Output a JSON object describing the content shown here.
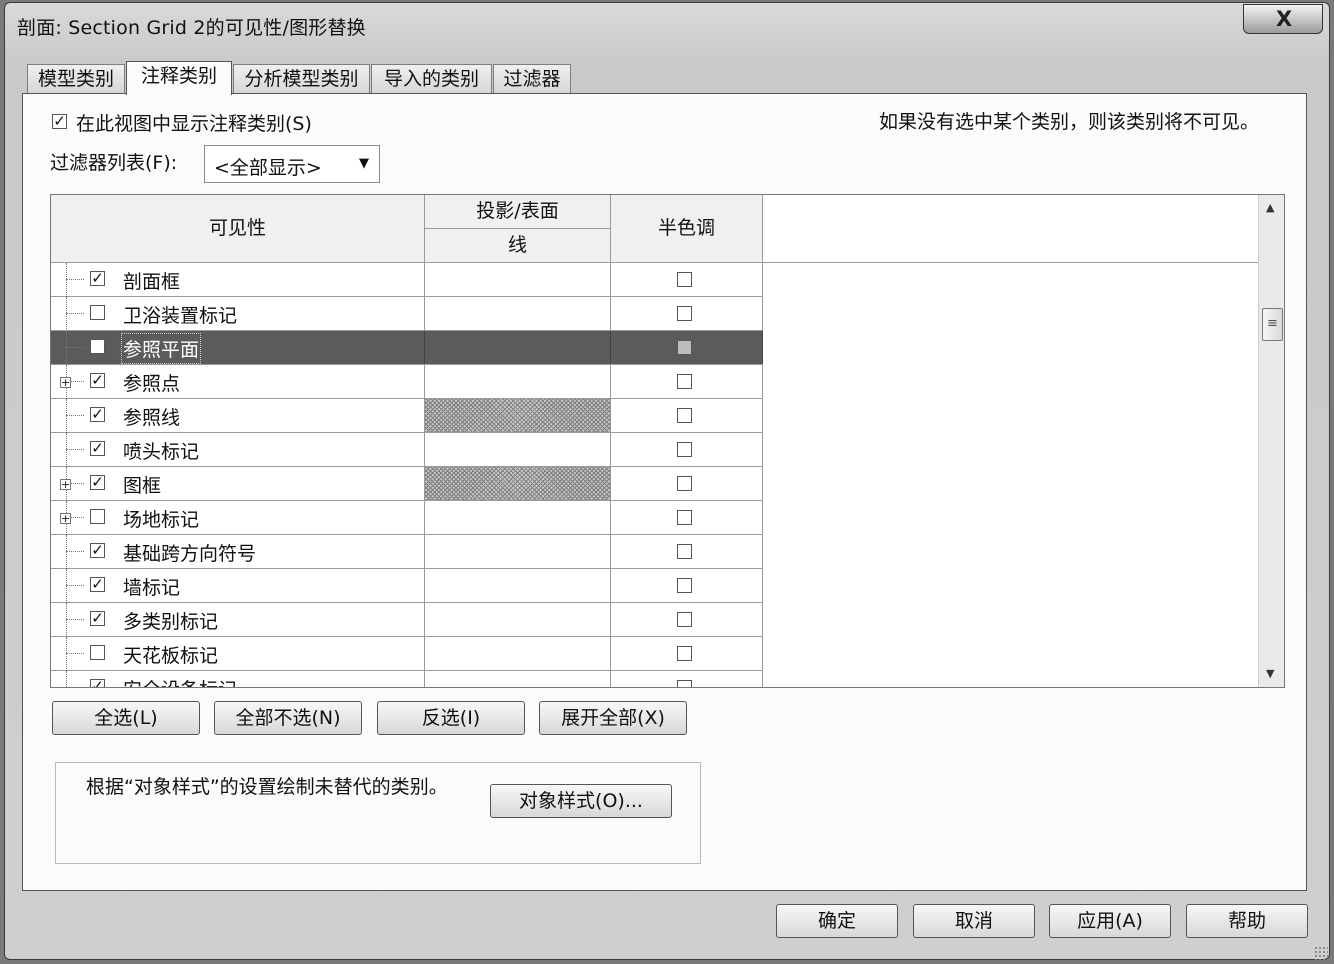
{
  "window": {
    "title": "剖面: Section Grid 2的可见性/图形替换",
    "close_label": "X"
  },
  "tabs": [
    {
      "label": "模型类别",
      "active": false
    },
    {
      "label": "注释类别",
      "active": true
    },
    {
      "label": "分析模型类别",
      "active": false
    },
    {
      "label": "导入的类别",
      "active": false
    },
    {
      "label": "过滤器",
      "active": false
    }
  ],
  "show_annotations": {
    "label": "在此视图中显示注释类别(S)",
    "checked": true
  },
  "info_text": "如果没有选中某个类别，则该类别将不可见。",
  "filter": {
    "label": "过滤器列表(F):",
    "value": "<全部显示>"
  },
  "grid": {
    "headers": {
      "visibility": "可见性",
      "projection": "投影/表面",
      "line": "线",
      "halftone": "半色调"
    },
    "rows": [
      {
        "name": "剖面框",
        "visible": true,
        "expandable": false,
        "hatched": false,
        "halftone": false,
        "selected": false
      },
      {
        "name": "卫浴装置标记",
        "visible": false,
        "expandable": false,
        "hatched": false,
        "halftone": false,
        "selected": false
      },
      {
        "name": "参照平面",
        "visible": false,
        "expandable": false,
        "hatched": false,
        "halftone": false,
        "selected": true
      },
      {
        "name": "参照点",
        "visible": true,
        "expandable": true,
        "hatched": false,
        "halftone": false,
        "selected": false
      },
      {
        "name": "参照线",
        "visible": true,
        "expandable": false,
        "hatched": true,
        "halftone": false,
        "selected": false
      },
      {
        "name": "喷头标记",
        "visible": true,
        "expandable": false,
        "hatched": false,
        "halftone": false,
        "selected": false
      },
      {
        "name": "图框",
        "visible": true,
        "expandable": true,
        "hatched": true,
        "halftone": false,
        "selected": false
      },
      {
        "name": "场地标记",
        "visible": false,
        "expandable": true,
        "hatched": false,
        "halftone": false,
        "selected": false
      },
      {
        "name": "基础跨方向符号",
        "visible": true,
        "expandable": false,
        "hatched": false,
        "halftone": false,
        "selected": false
      },
      {
        "name": "墙标记",
        "visible": true,
        "expandable": false,
        "hatched": false,
        "halftone": false,
        "selected": false
      },
      {
        "name": "多类别标记",
        "visible": true,
        "expandable": false,
        "hatched": false,
        "halftone": false,
        "selected": false
      },
      {
        "name": "天花板标记",
        "visible": false,
        "expandable": false,
        "hatched": false,
        "halftone": false,
        "selected": false
      },
      {
        "name": "安全设备标记",
        "visible": true,
        "expandable": false,
        "hatched": false,
        "halftone": false,
        "selected": false
      }
    ]
  },
  "selection_buttons": {
    "select_all": "全选(L)",
    "select_none": "全部不选(N)",
    "invert": "反选(I)",
    "expand_all": "展开全部(X)"
  },
  "object_styles": {
    "note": "根据“对象样式”的设置绘制未替代的类别。",
    "button": "对象样式(O)..."
  },
  "footer": {
    "ok": "确定",
    "cancel": "取消",
    "apply": "应用(A)",
    "help": "帮助"
  }
}
